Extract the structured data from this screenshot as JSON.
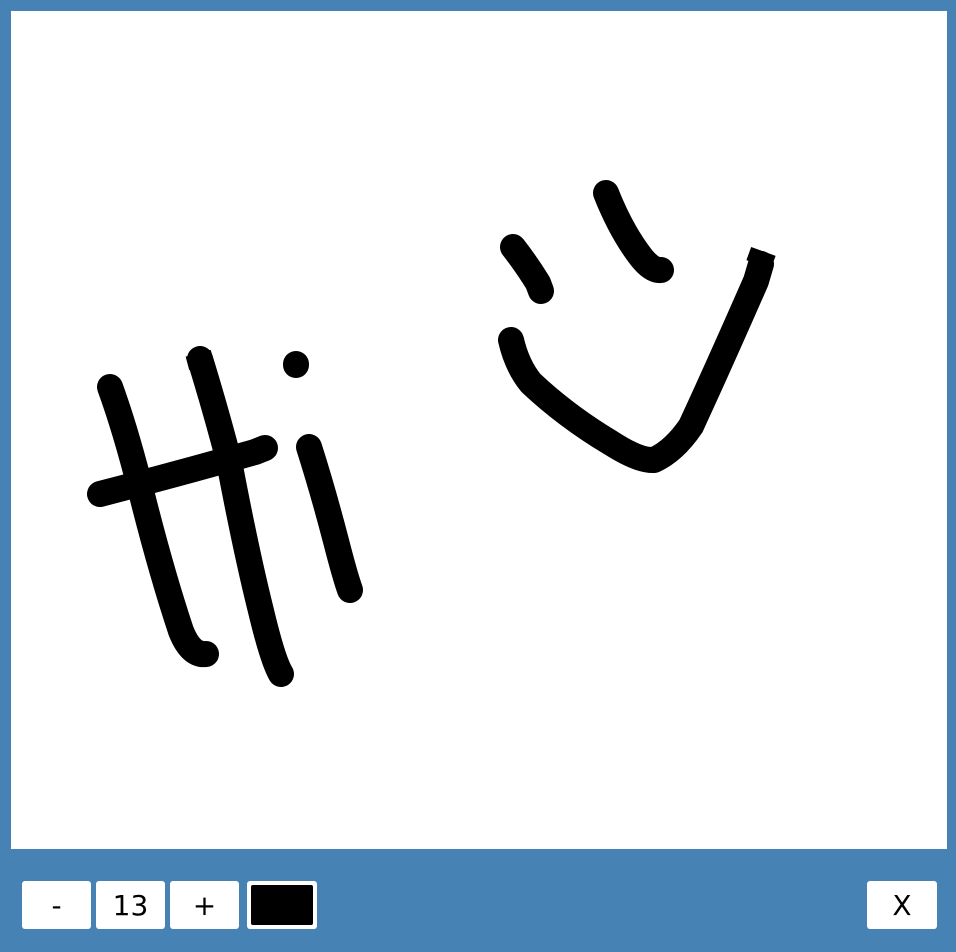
{
  "toolbar": {
    "decrease_label": "-",
    "brush_size": "13",
    "increase_label": "+",
    "selected_color": "#000000",
    "close_label": "X"
  },
  "colors": {
    "frame": "#4682b4",
    "canvas_background": "#ffffff",
    "ink": "#000000"
  }
}
